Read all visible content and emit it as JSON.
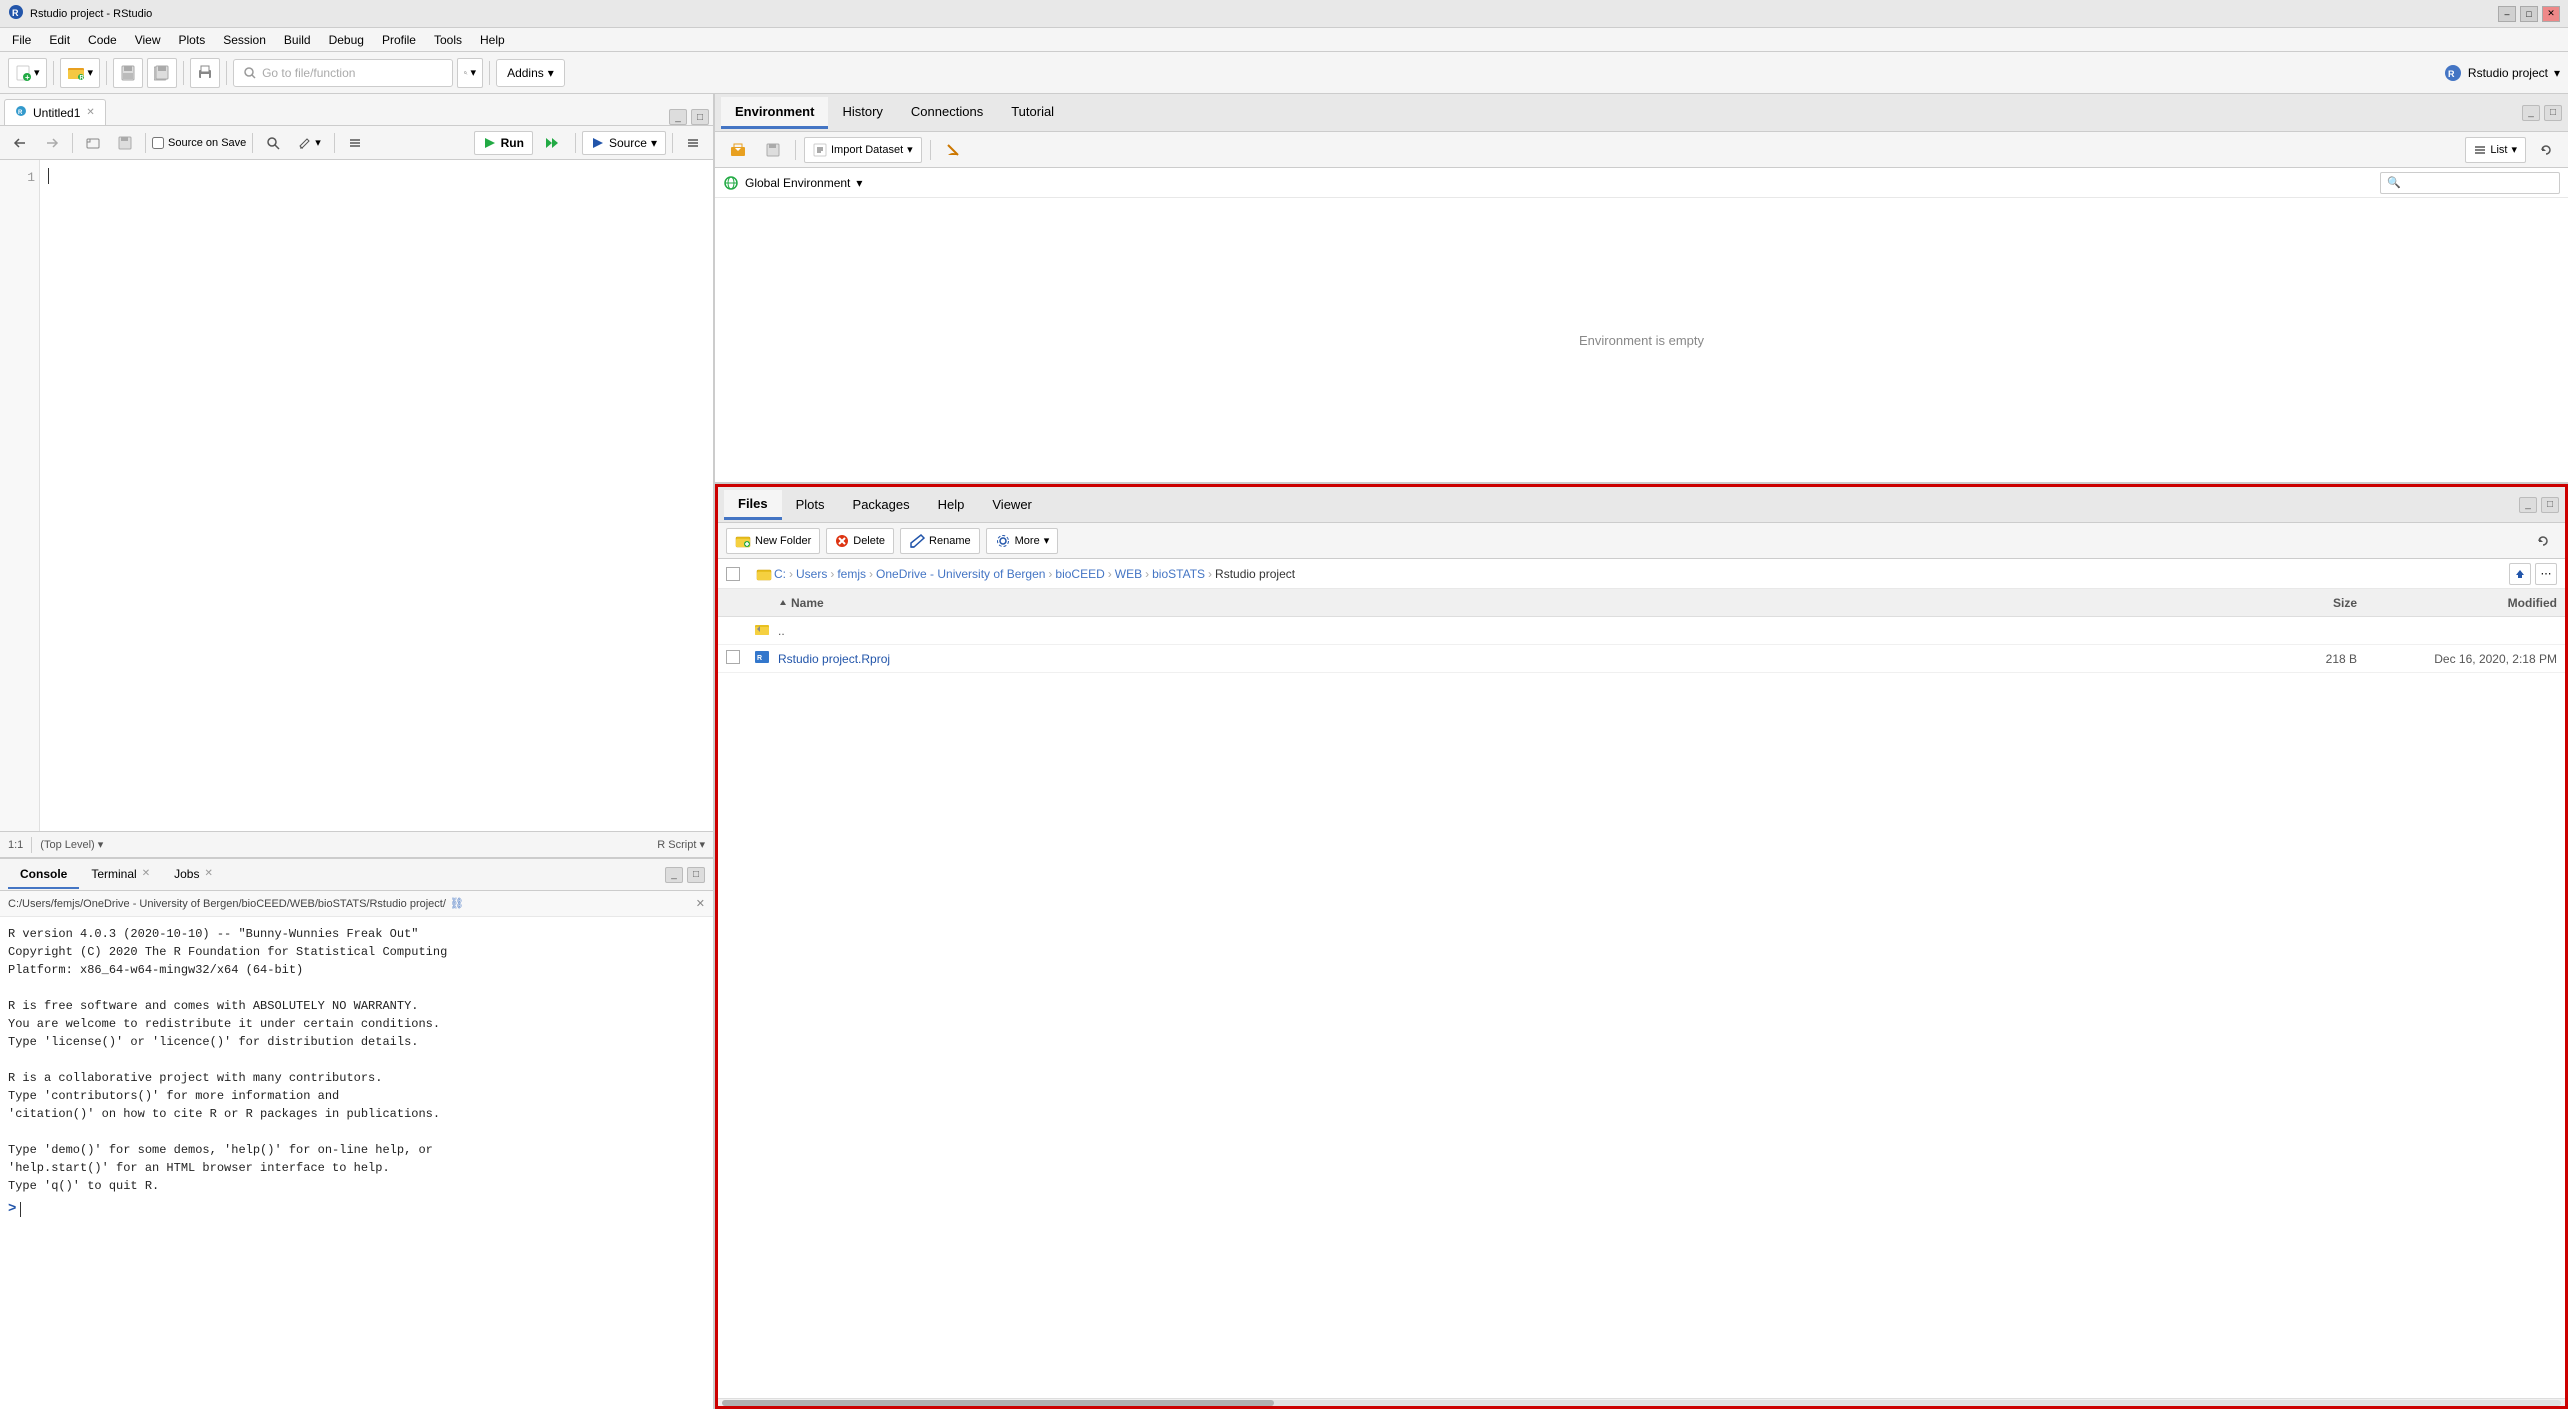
{
  "titlebar": {
    "title": "Rstudio project - RStudio",
    "controls": [
      "–",
      "□",
      "✕"
    ]
  },
  "menubar": {
    "items": [
      "File",
      "Edit",
      "Code",
      "View",
      "Plots",
      "Session",
      "Build",
      "Debug",
      "Profile",
      "Tools",
      "Help"
    ]
  },
  "toolbar": {
    "goto_placeholder": "Go to file/function",
    "addins_label": "Addins",
    "project_label": "Rstudio project"
  },
  "editor": {
    "tab_label": "Untitled1",
    "source_on_save": "Source on Save",
    "run_label": "Run",
    "source_label": "Source",
    "status": {
      "position": "1:1",
      "context": "(Top Level)",
      "file_type": "R Script"
    }
  },
  "console": {
    "tabs": [
      {
        "label": "Console",
        "active": true
      },
      {
        "label": "Terminal",
        "active": false
      },
      {
        "label": "Jobs",
        "active": false
      }
    ],
    "path": "C:/Users/femjs/OneDrive - University of Bergen/bioCEED/WEB/bioSTATS/Rstudio project/",
    "content": [
      "R version 4.0.3 (2020-10-10) -- \"Bunny-Wunnies Freak Out\"",
      "Copyright (C) 2020 The R Foundation for Statistical Computing",
      "Platform: x86_64-w64-mingw32/x64 (64-bit)",
      "",
      "R is free software and comes with ABSOLUTELY NO WARRANTY.",
      "You are welcome to redistribute it under certain conditions.",
      "Type 'license()' or 'licence()' for distribution details.",
      "",
      "R is a collaborative project with many contributors.",
      "Type 'contributors()' for more information and",
      "'citation()' on how to cite R or R packages in publications.",
      "",
      "Type 'demo()' for some demos, 'help()' for on-line help, or",
      "'help.start()' for an HTML browser interface to help.",
      "Type 'q()' to quit R."
    ],
    "prompt": ">"
  },
  "environment": {
    "tabs": [
      {
        "label": "Environment",
        "active": true
      },
      {
        "label": "History",
        "active": false
      },
      {
        "label": "Connections",
        "active": false
      },
      {
        "label": "Tutorial",
        "active": false
      }
    ],
    "toolbar": {
      "import_label": "Import Dataset",
      "list_label": "List"
    },
    "scope": "Global Environment",
    "empty_message": "Environment is empty"
  },
  "files": {
    "tabs": [
      {
        "label": "Files",
        "active": true
      },
      {
        "label": "Plots",
        "active": false
      },
      {
        "label": "Packages",
        "active": false
      },
      {
        "label": "Help",
        "active": false
      },
      {
        "label": "Viewer",
        "active": false
      }
    ],
    "toolbar": {
      "new_folder": "New Folder",
      "delete": "Delete",
      "rename": "Rename",
      "more": "More"
    },
    "breadcrumb": [
      "C:",
      "Users",
      "femjs",
      "OneDrive - University of Bergen",
      "bioCEED",
      "WEB",
      "bioSTATS",
      "Rstudio project"
    ],
    "columns": {
      "name": "Name",
      "size": "Size",
      "modified": "Modified"
    },
    "rows": [
      {
        "type": "parent",
        "name": ".."
      },
      {
        "type": "file",
        "name": "Rstudio project.Rproj",
        "size": "218 B",
        "modified": "Dec 16, 2020, 2:18 PM"
      }
    ]
  }
}
